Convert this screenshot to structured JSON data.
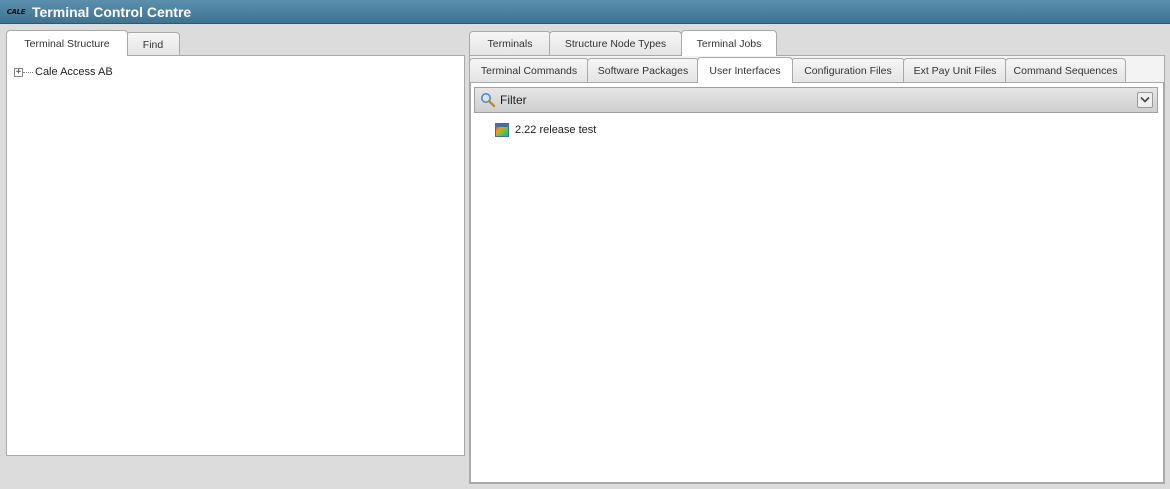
{
  "app": {
    "logo_text": "CALE",
    "title": "Terminal Control Centre"
  },
  "left_tabs": [
    "Terminal Structure",
    "Find"
  ],
  "tree": {
    "root_label": "Cale Access AB",
    "expander": "+"
  },
  "right_tabs": [
    "Terminals",
    "Structure Node Types",
    "Terminal Jobs"
  ],
  "sub_tabs": [
    "Terminal Commands",
    "Software Packages",
    "User Interfaces",
    "Configuration Files",
    "Ext Pay Unit Files",
    "Command Sequences"
  ],
  "filter": {
    "label": "Filter"
  },
  "items": [
    {
      "label": "2.22 release test"
    }
  ],
  "colors": {
    "titlebar": "#4a7f9f",
    "panel_border": "#a9a9a9"
  }
}
